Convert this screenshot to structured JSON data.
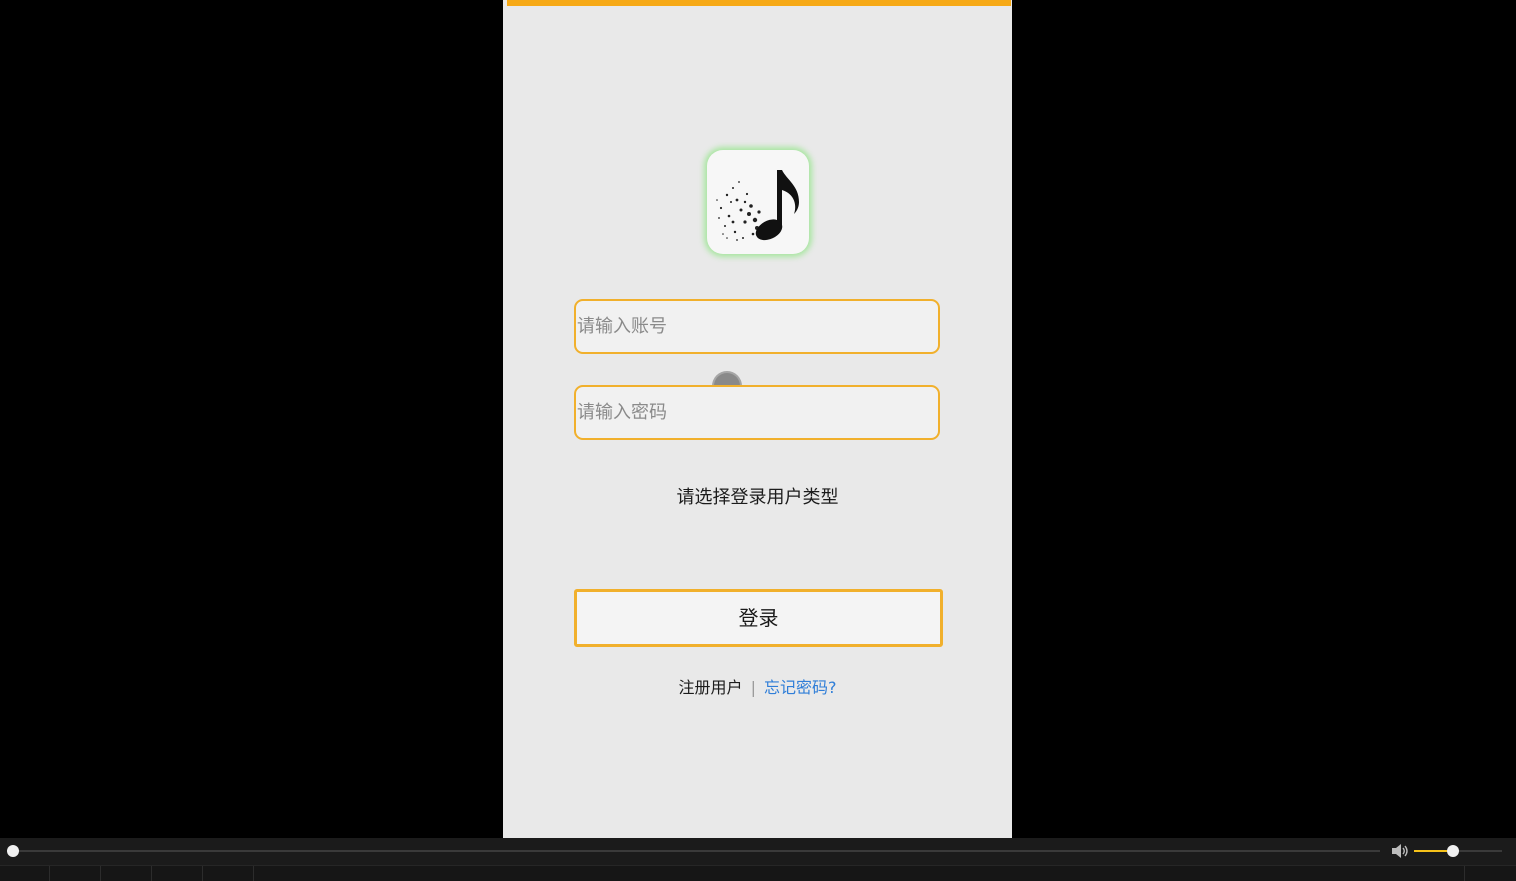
{
  "login": {
    "account_placeholder": "请输入账号",
    "password_placeholder": "请输入密码",
    "user_type_prompt": "请选择登录用户类型",
    "login_button": "登录",
    "register_link": "注册用户",
    "separator": "|",
    "forgot_link": "忘记密码?"
  },
  "icons": {
    "app_logo": "music-note-icon",
    "volume": "speaker-icon"
  },
  "player": {
    "seek_progress": 0,
    "volume_level": 0.45
  },
  "colors": {
    "accent": "#f6a916",
    "input_border": "#f1b02c",
    "link": "#2f7ed8",
    "logo_glow": "#a8e6a0",
    "volume_fill": "#f6c21a"
  }
}
